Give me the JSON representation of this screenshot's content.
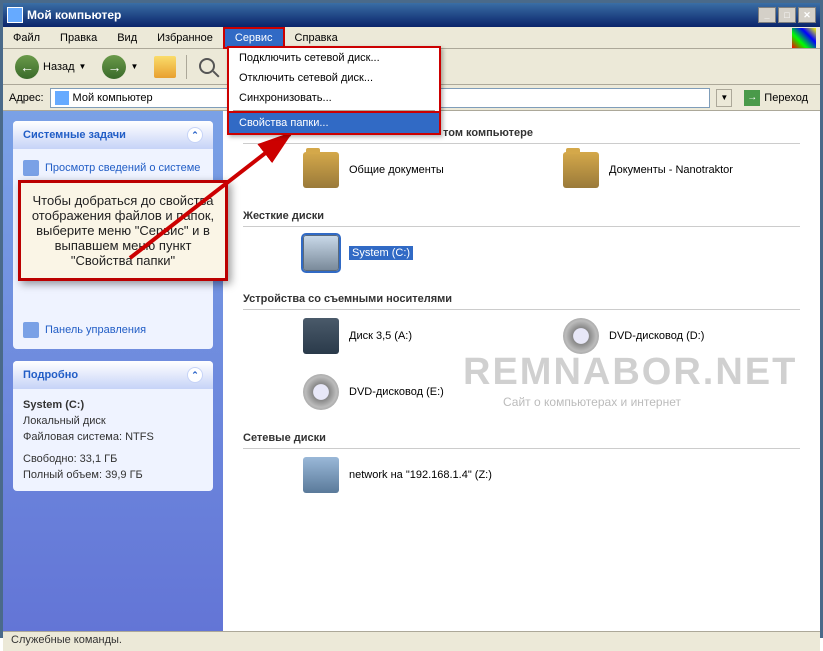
{
  "titlebar": {
    "title": "Мой компьютер"
  },
  "menubar": {
    "items": [
      "Файл",
      "Правка",
      "Вид",
      "Избранное",
      "Сервис",
      "Справка"
    ],
    "active_index": 4
  },
  "toolbar": {
    "back": "Назад"
  },
  "addressbar": {
    "label": "Адрес:",
    "value": "Мой компьютер",
    "go": "Переход"
  },
  "dropdown": {
    "items": [
      "Подключить сетевой диск...",
      "Отключить сетевой диск...",
      "Синхронизовать...",
      "Свойства папки..."
    ],
    "highlight_index": 3
  },
  "sidebar": {
    "tasks": {
      "title": "Системные задачи",
      "items": [
        "Просмотр сведений о системе",
        "Панель управления"
      ]
    },
    "details": {
      "title": "Подробно",
      "name": "System (C:)",
      "type": "Локальный диск",
      "fs": "Файловая система: NTFS",
      "free": "Свободно: 33,1 ГБ",
      "total": "Полный объем: 39,9 ГБ"
    }
  },
  "main": {
    "section1": {
      "title_suffix": "том компьютере",
      "items": [
        "Общие документы",
        "Документы - Nanotraktor"
      ]
    },
    "section2": {
      "title": "Жесткие диски",
      "items": [
        "System (C:)"
      ]
    },
    "section3": {
      "title": "Устройства со съемными носителями",
      "items": [
        "Диск 3,5 (A:)",
        "DVD-дисковод (D:)",
        "DVD-дисковод (E:)"
      ]
    },
    "section4": {
      "title": "Сетевые диски",
      "items": [
        "network на \"192.168.1.4\" (Z:)"
      ]
    }
  },
  "callout": {
    "text": "Чтобы добраться до свойства отображения файлов и папок, выберите меню \"Сервис\" и в выпавшем меню пункт \"Свойства папки\""
  },
  "watermark": {
    "main": "REMNABOR.NET",
    "sub": "Сайт о компьютерах и интернет"
  },
  "statusbar": {
    "text": "Служебные команды."
  }
}
